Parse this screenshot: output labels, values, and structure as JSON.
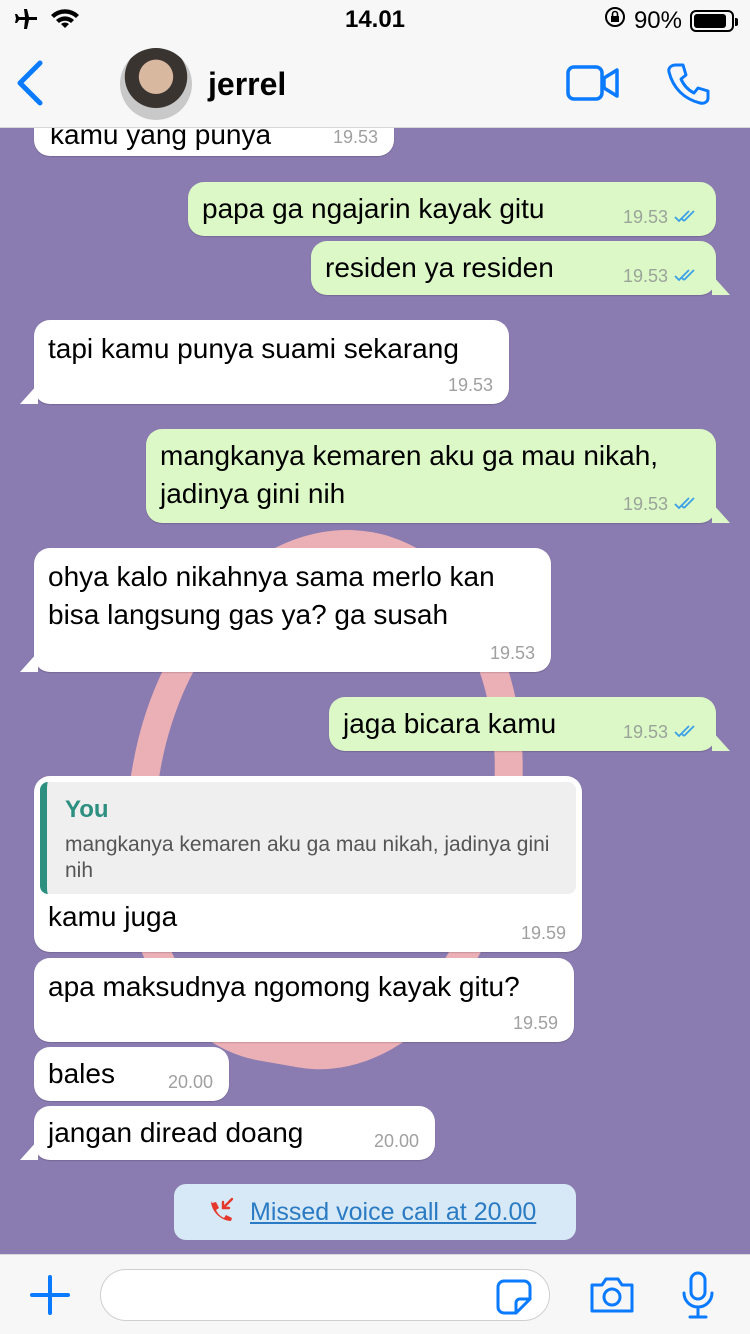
{
  "status_bar": {
    "time": "14.01",
    "battery": "90%",
    "battery_level": 0.9
  },
  "header": {
    "contact_name": "jerrel"
  },
  "messages": [
    {
      "dir": "in",
      "text": "kamu yang punya",
      "time": "19.53"
    },
    {
      "dir": "out",
      "text": "papa ga ngajarin kayak gitu",
      "time": "19.53"
    },
    {
      "dir": "out",
      "text": "residen ya residen",
      "time": "19.53"
    },
    {
      "dir": "in",
      "text": "tapi kamu punya suami sekarang",
      "time": "19.53"
    },
    {
      "dir": "out",
      "text": "mangkanya kemaren aku ga mau nikah, jadinya gini nih",
      "time": "19.53"
    },
    {
      "dir": "in",
      "text": "ohya kalo nikahnya sama merlo kan bisa langsung gas ya? ga susah",
      "time": "19.53"
    },
    {
      "dir": "out",
      "text": "jaga bicara kamu",
      "time": "19.53"
    },
    {
      "dir": "in",
      "text": "kamu juga",
      "time": "19.59",
      "quote": {
        "author": "You",
        "text": "mangkanya kemaren aku ga mau nikah, jadinya gini nih"
      }
    },
    {
      "dir": "in",
      "text": "apa maksudnya ngomong kayak gitu?",
      "time": "19.59"
    },
    {
      "dir": "in",
      "text": "bales",
      "time": "20.00"
    },
    {
      "dir": "in",
      "text": "jangan diread doang",
      "time": "20.00"
    }
  ],
  "missed_call": {
    "text": "Missed voice call at 20.00"
  },
  "colors": {
    "accent": "#0a7aff",
    "outgoing_bubble": "#dcf8c6",
    "wallpaper": "#8a7bb0",
    "missed_call_bg": "#d7e9f7"
  }
}
